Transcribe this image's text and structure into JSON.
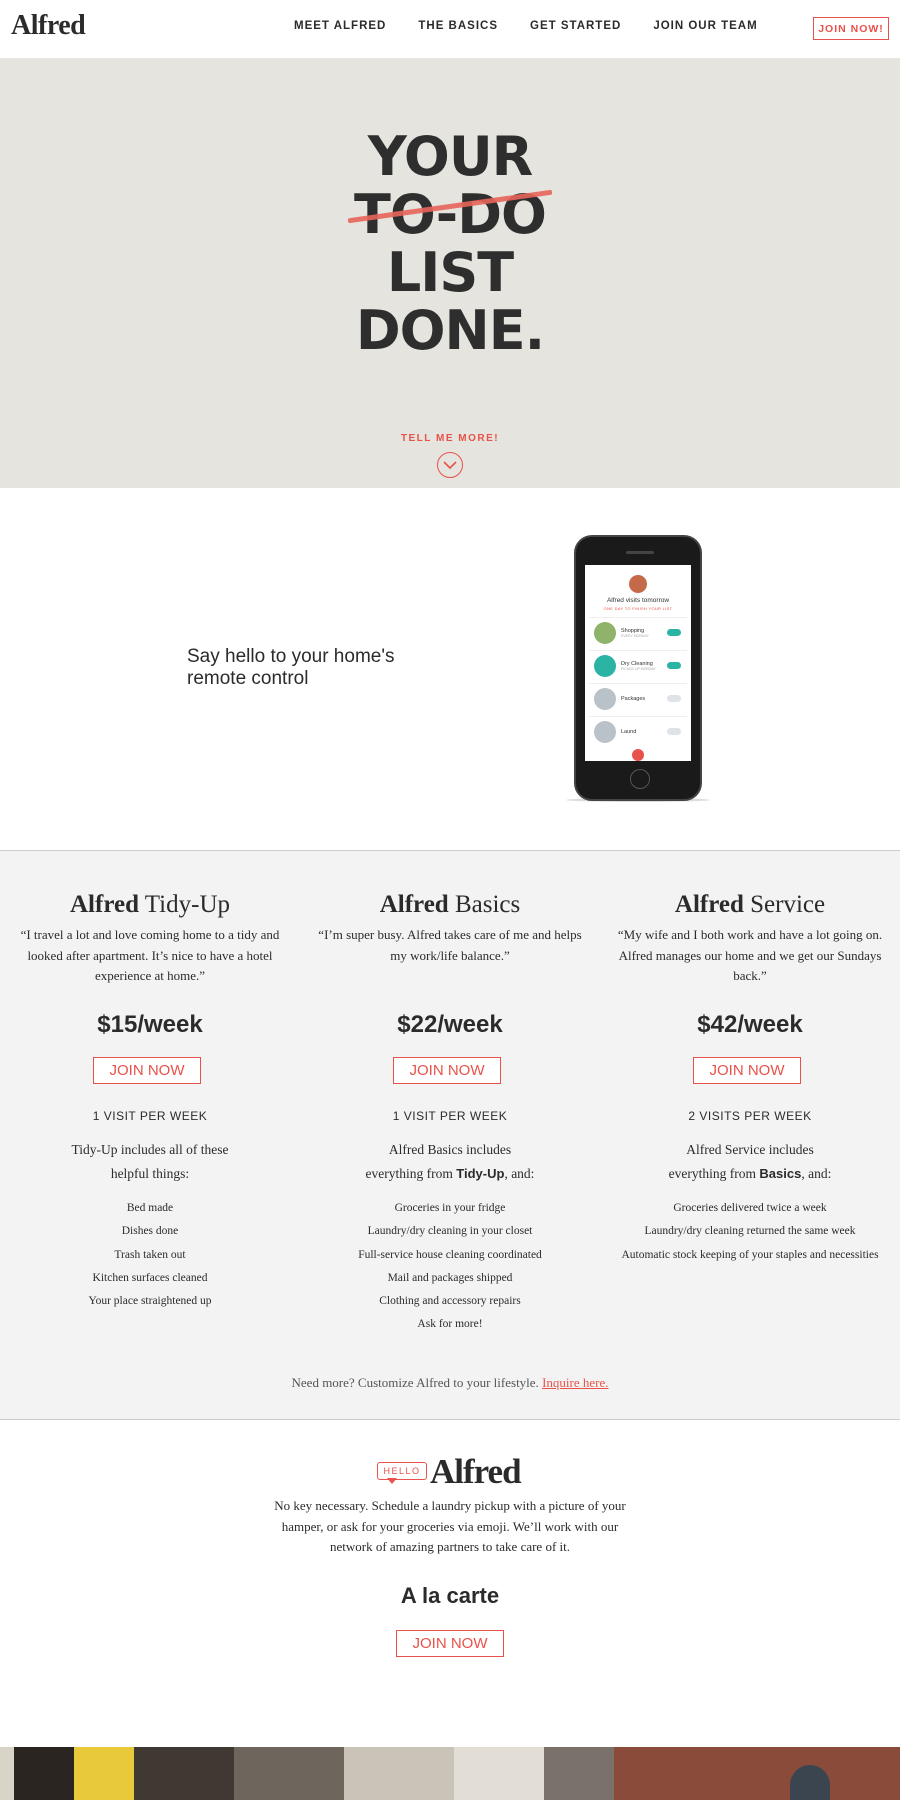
{
  "nav": {
    "logo": "Alfred",
    "links": [
      "MEET ALFRED",
      "THE BASICS",
      "GET STARTED",
      "JOIN OUR TEAM"
    ],
    "join": "JOIN NOW!"
  },
  "hero": {
    "lines": [
      "YOUR",
      "TO-DO",
      "LIST",
      "DONE."
    ],
    "tell_more": "TELL ME MORE!",
    "accent": "#e8524a",
    "background": "#e5e4df"
  },
  "remote": {
    "text": "Say hello to your home's remote control",
    "app": {
      "title": "Alfred visits tomorrow",
      "subtitle": "ONE DAY TO FINISH YOUR LIST",
      "rows": [
        {
          "label": "Shopping",
          "sub": "EVERY MONDAY",
          "color": "#8fb36a",
          "on": true
        },
        {
          "label": "Dry Cleaning",
          "sub": "PICKED UP MONDAY",
          "color": "#2bb3a3",
          "on": true
        },
        {
          "label": "Packages",
          "sub": "",
          "color": "#b9c1c9",
          "on": false
        },
        {
          "label": "Laund",
          "sub": "",
          "color": "#b9c1c9",
          "on": false
        }
      ]
    }
  },
  "plans": [
    {
      "name_bold": "Alfred",
      "name_rest": " Tidy-Up",
      "quote": "“I travel a lot and love coming home to a tidy and looked after apartment. It’s nice to have a hotel experience at home.”",
      "price": "$15/week",
      "button": "JOIN NOW",
      "visits": "1 VISIT PER WEEK",
      "desc_pre": "Tidy-Up includes all of these helpful things:",
      "desc_bold": "",
      "desc_post": "",
      "items": [
        "Bed made",
        "Dishes done",
        "Trash taken out",
        "Kitchen surfaces cleaned",
        "Your place straightened up"
      ]
    },
    {
      "name_bold": "Alfred",
      "name_rest": " Basics",
      "quote": "“I’m super busy. Alfred takes care of me and helps my work/life balance.”",
      "price": "$22/week",
      "button": "JOIN NOW",
      "visits": "1 VISIT PER WEEK",
      "desc_pre": "Alfred Basics includes everything from ",
      "desc_bold": "Tidy-Up",
      "desc_post": ", and:",
      "items": [
        "Groceries in your fridge",
        "Laundry/dry cleaning in your closet",
        "Full-service house cleaning coordinated",
        "Mail and packages shipped",
        "Clothing and accessory repairs",
        "Ask for more!"
      ]
    },
    {
      "name_bold": "Alfred",
      "name_rest": " Service",
      "quote": "“My wife and I both work and have a lot going on. Alfred manages our home and we get our Sundays back.”",
      "price": "$42/week",
      "button": "JOIN NOW",
      "visits": "2 VISITS PER WEEK",
      "desc_pre": "Alfred Service includes everything from ",
      "desc_bold": "Basics",
      "desc_post": ", and:",
      "items": [
        "Groceries delivered twice a week",
        "Laundry/dry cleaning returned the same week",
        "Automatic stock keeping of your staples and necessities"
      ]
    }
  ],
  "need_more": {
    "text": "Need more? Customize Alfred to your lifestyle. ",
    "link": "Inquire here."
  },
  "hello": {
    "badge": "HELLO",
    "logo": "Alfred",
    "text": "No key necessary. Schedule a laundry pickup with a picture of your hamper, or ask for your groceries via emoji. We’ll work with our network of amazing partners to take care of it.",
    "carte_title": "A la carte",
    "carte_button": "JOIN NOW"
  }
}
